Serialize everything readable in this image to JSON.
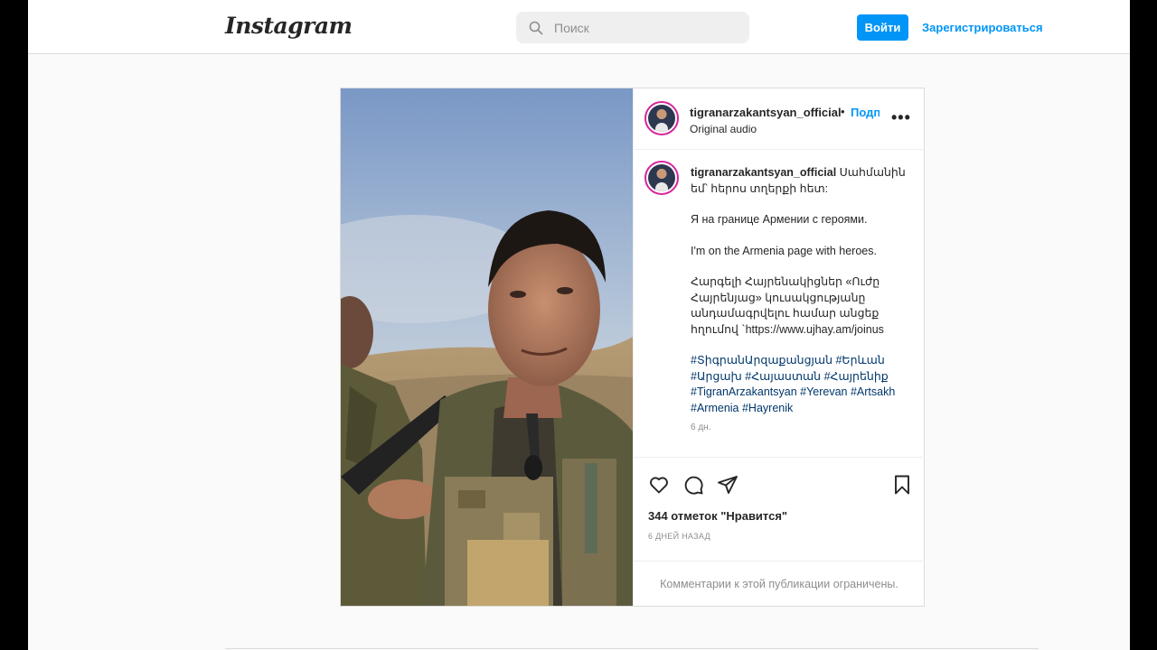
{
  "header": {
    "logo_text": "Instagram",
    "search_placeholder": "Поиск",
    "login_label": "Войти",
    "signup_label": "Зарегистрироваться"
  },
  "post": {
    "username": "tigranarzakantsyan_official",
    "separator": "•",
    "follow_label": "Подписаться",
    "audio_label": "Original audio",
    "more_label": "•••",
    "caption": {
      "username": "tigranarzakantsyan_official",
      "line1": "Սահմանին եմ՝ հերոս տղերքի հետ:",
      "line2": "Я на границе Армении с героями.",
      "line3": "I'm on the Armenia page with heroes.",
      "line4": "Հարգելի Հայրենակիցներ «Ուժը Հայրենյաց» կուսակցությանը անդամագրվելու համար անցեք հղումով `https://www.ujhay.am/joinus",
      "hashtags": "#ՏիգրանԱրզաքանցյան #Երևան #Արցախ #Հայաստան #Հայրենիք #TigranArzakantsyan #Yerevan #Artsakh #Armenia #Hayrenik",
      "time": "6 дн."
    },
    "likes": "344 отметок \"Нравится\"",
    "posted_ago": "6 ДНЕЙ НАЗАД",
    "comments_note": "Комментарии к этой публикации ограничены."
  },
  "colors": {
    "accent": "#0095f6",
    "hashtag": "#00376b",
    "muted": "#8e8e8e",
    "border": "#dbdbdb"
  },
  "icons": [
    "search-icon",
    "more-icon",
    "heart-icon",
    "comment-icon",
    "share-icon",
    "bookmark-icon"
  ]
}
